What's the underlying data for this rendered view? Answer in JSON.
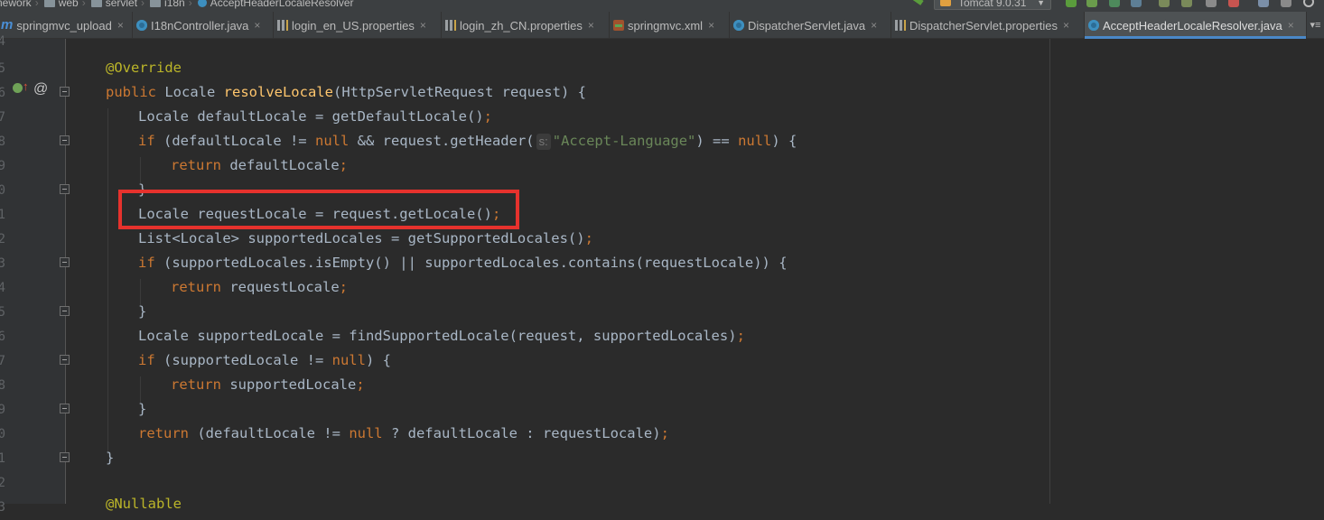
{
  "navbar": {
    "breadcrumbs": [
      "nework",
      "web",
      "servlet",
      "i18n",
      "AcceptHeaderLocaleResolver"
    ],
    "run_config": "Tomcat 9.0.31"
  },
  "tabs": [
    {
      "label": "springmvc_upload",
      "icon": "module-icon"
    },
    {
      "label": "I18nController.java",
      "icon": "class-icon"
    },
    {
      "label": "login_en_US.properties",
      "icon": "properties-icon"
    },
    {
      "label": "login_zh_CN.properties",
      "icon": "properties-icon"
    },
    {
      "label": "springmvc.xml",
      "icon": "xml-icon"
    },
    {
      "label": "DispatcherServlet.java",
      "icon": "class-icon"
    },
    {
      "label": "DispatcherServlet.properties",
      "icon": "properties-icon"
    },
    {
      "label": "AcceptHeaderLocaleResolver.java",
      "icon": "class-icon",
      "active": true
    }
  ],
  "editor": {
    "line_numbers": [
      "4",
      "5",
      "6",
      "7",
      "8",
      "9",
      "0",
      "1",
      "2",
      "3",
      "4",
      "5",
      "6",
      "7",
      "8",
      "9",
      "0",
      "1",
      "2",
      "3"
    ],
    "code": {
      "l1": {
        "ann": "@Override"
      },
      "l2": {
        "k1": "public",
        "t1": " Locale ",
        "fn": "resolveLocale",
        "t2": "(HttpServletRequest request) {"
      },
      "l3": {
        "t1": "Locale defaultLocale = getDefaultLocale()",
        "semi": ";"
      },
      "l4": {
        "k1": "if",
        "t1": " (defaultLocale != ",
        "k2": "null",
        "t2": " && request.getHeader(",
        "hint": "s:",
        "str": "\"Accept-Language\"",
        "t3": ") == ",
        "k3": "null",
        "t4": ") {"
      },
      "l5": {
        "k1": "return",
        "t1": " defaultLocale",
        "semi": ";"
      },
      "l6": {
        "t1": "}"
      },
      "l7": {
        "t1": "Locale requestLocale = request.getLocale()",
        "semi": ";"
      },
      "l8": {
        "t1": "List<Locale> supportedLocales = getSupportedLocales()",
        "semi": ";"
      },
      "l9": {
        "k1": "if",
        "t1": " (supportedLocales.isEmpty() || supportedLocales.contains(requestLocale)) {"
      },
      "l10": {
        "k1": "return",
        "t1": " requestLocale",
        "semi": ";"
      },
      "l11": {
        "t1": "}"
      },
      "l12": {
        "t1": "Locale supportedLocale = findSupportedLocale(request, supportedLocales)",
        "semi": ";"
      },
      "l13": {
        "k1": "if",
        "t1": " (supportedLocale != ",
        "k2": "null",
        "t2": ") {"
      },
      "l14": {
        "k1": "return",
        "t1": " supportedLocale",
        "semi": ";"
      },
      "l15": {
        "t1": "}"
      },
      "l16": {
        "k1": "return",
        "t1": " (defaultLocale != ",
        "k2": "null",
        "t2": " ? defaultLocale : requestLocale)",
        "semi": ";"
      },
      "l17": {
        "t1": "}"
      },
      "l18": {
        "ann": "@Nullable"
      }
    }
  },
  "colors": {
    "background": "#2b2b2b",
    "keyword": "#cc7832",
    "method": "#ffc66d",
    "string": "#6a8759",
    "annotation": "#bbb529",
    "highlight_box": "#e6322d",
    "active_tab_underline": "#4a88c7"
  }
}
